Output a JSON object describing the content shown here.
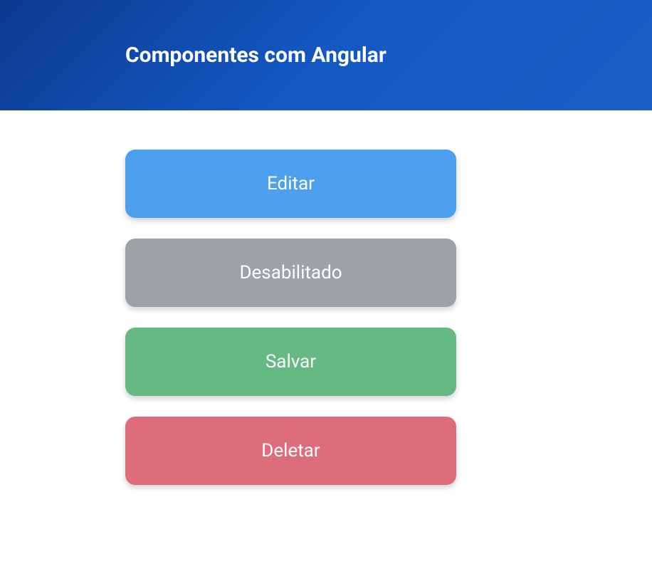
{
  "header": {
    "title": "Componentes com Angular"
  },
  "buttons": {
    "edit": {
      "label": "Editar",
      "color": "#4da0ee"
    },
    "disabled": {
      "label": "Desabilitado",
      "color": "#9ea2a4"
    },
    "save": {
      "label": "Salvar",
      "color": "#65b983"
    },
    "delete": {
      "label": "Deletar",
      "color": "#de6d7c"
    }
  }
}
